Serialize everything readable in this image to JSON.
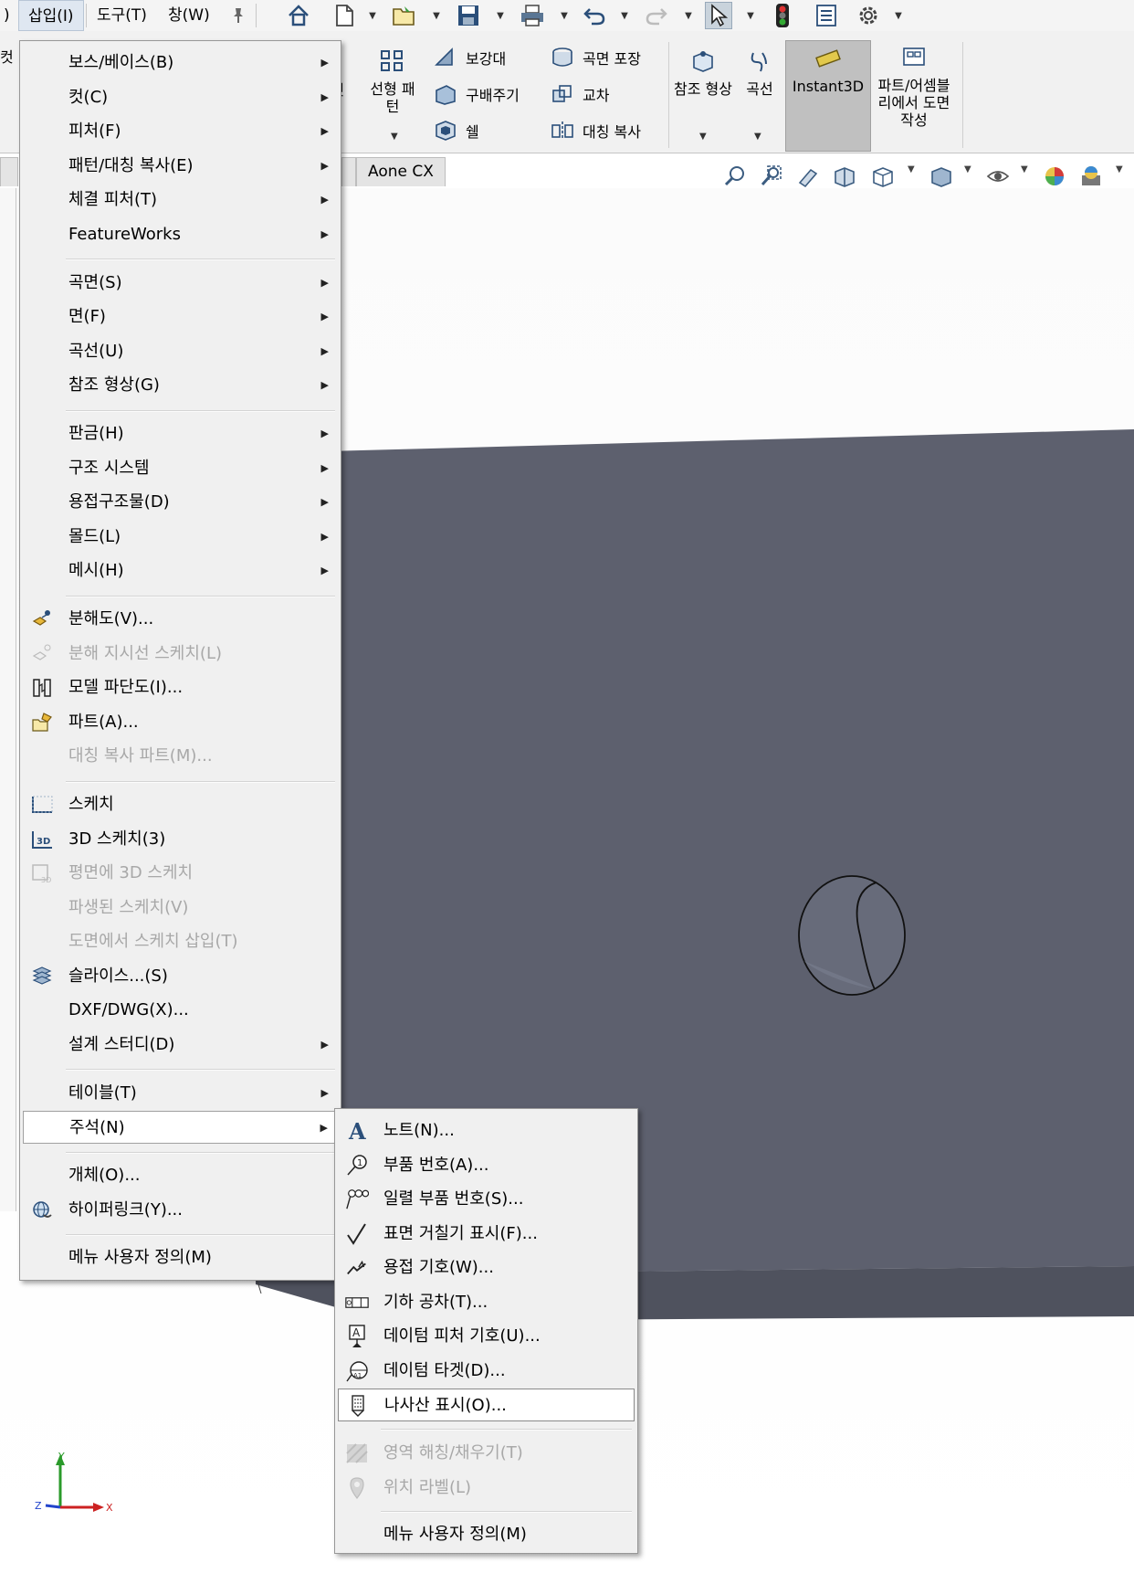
{
  "menubar": {
    "prev_fragment": ")",
    "items": [
      "삽입(I)",
      "도구(T)",
      "창(W)"
    ],
    "pin_icon": "pin-icon"
  },
  "toolbar": {
    "icons": [
      "home-icon",
      "new-document-icon",
      "open-icon",
      "save-icon",
      "print-icon",
      "undo-icon",
      "redo-icon",
      "select-pointer-icon",
      "rebuild-traffic-light-icon",
      "file-properties-icon",
      "options-gear-icon"
    ]
  },
  "ribbon": {
    "left_fragment": "컷",
    "fillet_fragment": "렛",
    "linear_pattern": "선형 패턴",
    "rib": "보강대",
    "draft": "구배주기",
    "shell": "쉘",
    "wrap": "곡면 포장",
    "intersect": "교차",
    "mirror": "대칭 복사",
    "ref_geometry": "참조 형상",
    "curves": "곡선",
    "instant3d": "Instant3D",
    "make_drawing": "파트/어셈블리에서 도면 작성"
  },
  "tabs": {
    "aone": "Aone CX"
  },
  "insert_menu": {
    "groups": [
      [
        {
          "label": "보스/베이스(B)",
          "sub": true
        },
        {
          "label": "컷(C)",
          "sub": true
        },
        {
          "label": "피처(F)",
          "sub": true
        },
        {
          "label": "패턴/대칭 복사(E)",
          "sub": true
        },
        {
          "label": "체결 피처(T)",
          "sub": true
        },
        {
          "label": "FeatureWorks",
          "sub": true
        }
      ],
      [
        {
          "label": "곡면(S)",
          "sub": true
        },
        {
          "label": "면(F)",
          "sub": true
        },
        {
          "label": "곡선(U)",
          "sub": true
        },
        {
          "label": "참조 형상(G)",
          "sub": true
        }
      ],
      [
        {
          "label": "판금(H)",
          "sub": true
        },
        {
          "label": "구조 시스템",
          "sub": true
        },
        {
          "label": "용접구조물(D)",
          "sub": true
        },
        {
          "label": "몰드(L)",
          "sub": true
        },
        {
          "label": "메시(H)",
          "sub": true
        }
      ],
      [
        {
          "label": "분해도(V)...",
          "icon": "exploded-view-icon"
        },
        {
          "label": "분해 지시선 스케치(L)",
          "icon": "explode-line-sketch-icon",
          "disabled": true
        },
        {
          "label": "모델 파단도(I)...",
          "icon": "model-break-view-icon"
        },
        {
          "label": "파트(A)...",
          "icon": "insert-part-icon"
        },
        {
          "label": "대칭 복사 파트(M)...",
          "disabled": true
        }
      ],
      [
        {
          "label": "스케치",
          "icon": "sketch-icon"
        },
        {
          "label": "3D 스케치(3)",
          "icon": "3d-sketch-icon"
        },
        {
          "label": "평면에 3D 스케치",
          "icon": "3d-sketch-on-plane-icon",
          "disabled": true
        },
        {
          "label": "파생된 스케치(V)",
          "disabled": true
        },
        {
          "label": "도면에서 스케치 삽입(T)",
          "disabled": true
        },
        {
          "label": "슬라이스...(S)",
          "icon": "slicing-icon"
        },
        {
          "label": "DXF/DWG(X)..."
        },
        {
          "label": "설계 스터디(D)",
          "sub": true
        }
      ],
      [
        {
          "label": "테이블(T)",
          "sub": true
        },
        {
          "label": "주석(N)",
          "sub": true,
          "highlight": true
        }
      ],
      [
        {
          "label": "개체(O)..."
        },
        {
          "label": "하이퍼링크(Y)...",
          "icon": "hyperlink-globe-icon"
        }
      ],
      [
        {
          "label": "메뉴 사용자 정의(M)"
        }
      ]
    ]
  },
  "annotations_menu": {
    "items": [
      {
        "label": "노트(N)...",
        "icon": "note-icon"
      },
      {
        "label": "부품 번호(A)...",
        "icon": "balloon-icon"
      },
      {
        "label": "일렬 부품 번호(S)...",
        "icon": "stacked-balloon-icon"
      },
      {
        "label": "표면 거칠기 표시(F)...",
        "icon": "surface-finish-icon"
      },
      {
        "label": "용접 기호(W)...",
        "icon": "weld-symbol-icon"
      },
      {
        "label": "기하 공차(T)...",
        "icon": "geometric-tolerance-icon"
      },
      {
        "label": "데이텀 피처 기호(U)...",
        "icon": "datum-feature-icon"
      },
      {
        "label": "데이텀 타겟(D)...",
        "icon": "datum-target-icon"
      },
      {
        "label": "나사산 표시(O)...",
        "icon": "cosmetic-thread-icon",
        "highlight": true
      }
    ],
    "items2": [
      {
        "label": "영역 해칭/채우기(T)",
        "icon": "area-hatch-icon",
        "disabled": true
      },
      {
        "label": "위치 라벨(L)",
        "icon": "location-label-icon",
        "disabled": true
      }
    ],
    "items3": [
      {
        "label": "메뉴 사용자 정의(M)"
      }
    ]
  },
  "triad": {
    "y": "Y",
    "x": "X",
    "z": "Z"
  },
  "colors": {
    "model_face": "#5d606e",
    "model_bottom": "#4f525e",
    "hole_fill": "#676b7a"
  }
}
